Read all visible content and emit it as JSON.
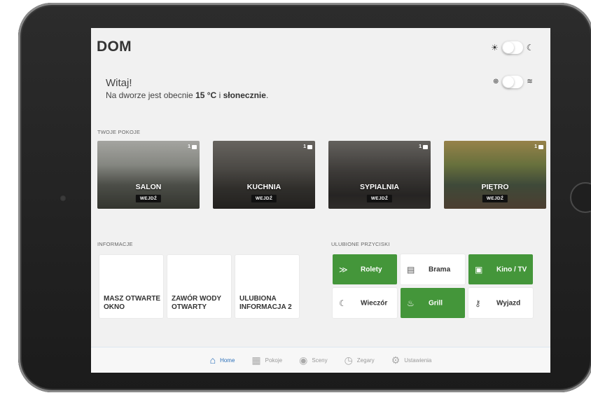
{
  "app": {
    "title": "DOM"
  },
  "header": {
    "theme_toggle": {
      "left_icon": "sun-icon",
      "right_icon": "moon-icon",
      "left_glyph": "☀",
      "right_glyph": "☾"
    }
  },
  "welcome": {
    "greeting": "Witaj!",
    "weather_prefix": "Na dworze jest obecnie ",
    "temperature": "15 °C",
    "weather_mid": " i ",
    "condition": "słonecznie",
    "weather_suffix": ".",
    "connection_toggle": {
      "left_icon": "globe-icon",
      "right_icon": "wifi-icon",
      "left_glyph": "⊕",
      "right_glyph": "≋"
    }
  },
  "rooms": {
    "section_title": "TWOJE POKOJE",
    "enter_label": "WEJDŹ",
    "items": [
      {
        "name": "SALON",
        "count": "1"
      },
      {
        "name": "KUCHNIA",
        "count": "1"
      },
      {
        "name": "SYPIALNIA",
        "count": "1"
      },
      {
        "name": "PIĘTRO",
        "count": "1"
      }
    ]
  },
  "info": {
    "section_title": "INFORMACJE",
    "items": [
      {
        "label": "MASZ OTWARTE OKNO"
      },
      {
        "label": "ZAWÓR WODY OTWARTY"
      },
      {
        "label": "ULUBIONA INFORMACJA 2"
      }
    ]
  },
  "favorites": {
    "section_title": "ULUBIONE PRZYCISKI",
    "items": [
      {
        "label": "Rolety",
        "icon": "chevrons-down-icon",
        "glyph": "≫",
        "active": true
      },
      {
        "label": "Brama",
        "icon": "garage-icon",
        "glyph": "▤",
        "active": false
      },
      {
        "label": "Kino / TV",
        "icon": "tv-icon",
        "glyph": "▣",
        "active": true
      },
      {
        "label": "Wieczór",
        "icon": "moon-icon",
        "glyph": "☾",
        "active": false
      },
      {
        "label": "Grill",
        "icon": "grill-icon",
        "glyph": "♨",
        "active": true
      },
      {
        "label": "Wyjazd",
        "icon": "key-icon",
        "glyph": "⚷",
        "active": false
      }
    ],
    "active_color": "#44963a"
  },
  "tabbar": {
    "items": [
      {
        "label": "Home",
        "icon": "home-icon",
        "glyph": "⌂",
        "active": true
      },
      {
        "label": "Pokoje",
        "icon": "grid-icon",
        "glyph": "▦",
        "active": false
      },
      {
        "label": "Sceny",
        "icon": "eye-icon",
        "glyph": "◉",
        "active": false
      },
      {
        "label": "Zegary",
        "icon": "clock-icon",
        "glyph": "◷",
        "active": false
      },
      {
        "label": "Ustawienia",
        "icon": "gear-icon",
        "glyph": "⚙",
        "active": false
      }
    ],
    "active_color": "#2a6fb9"
  }
}
